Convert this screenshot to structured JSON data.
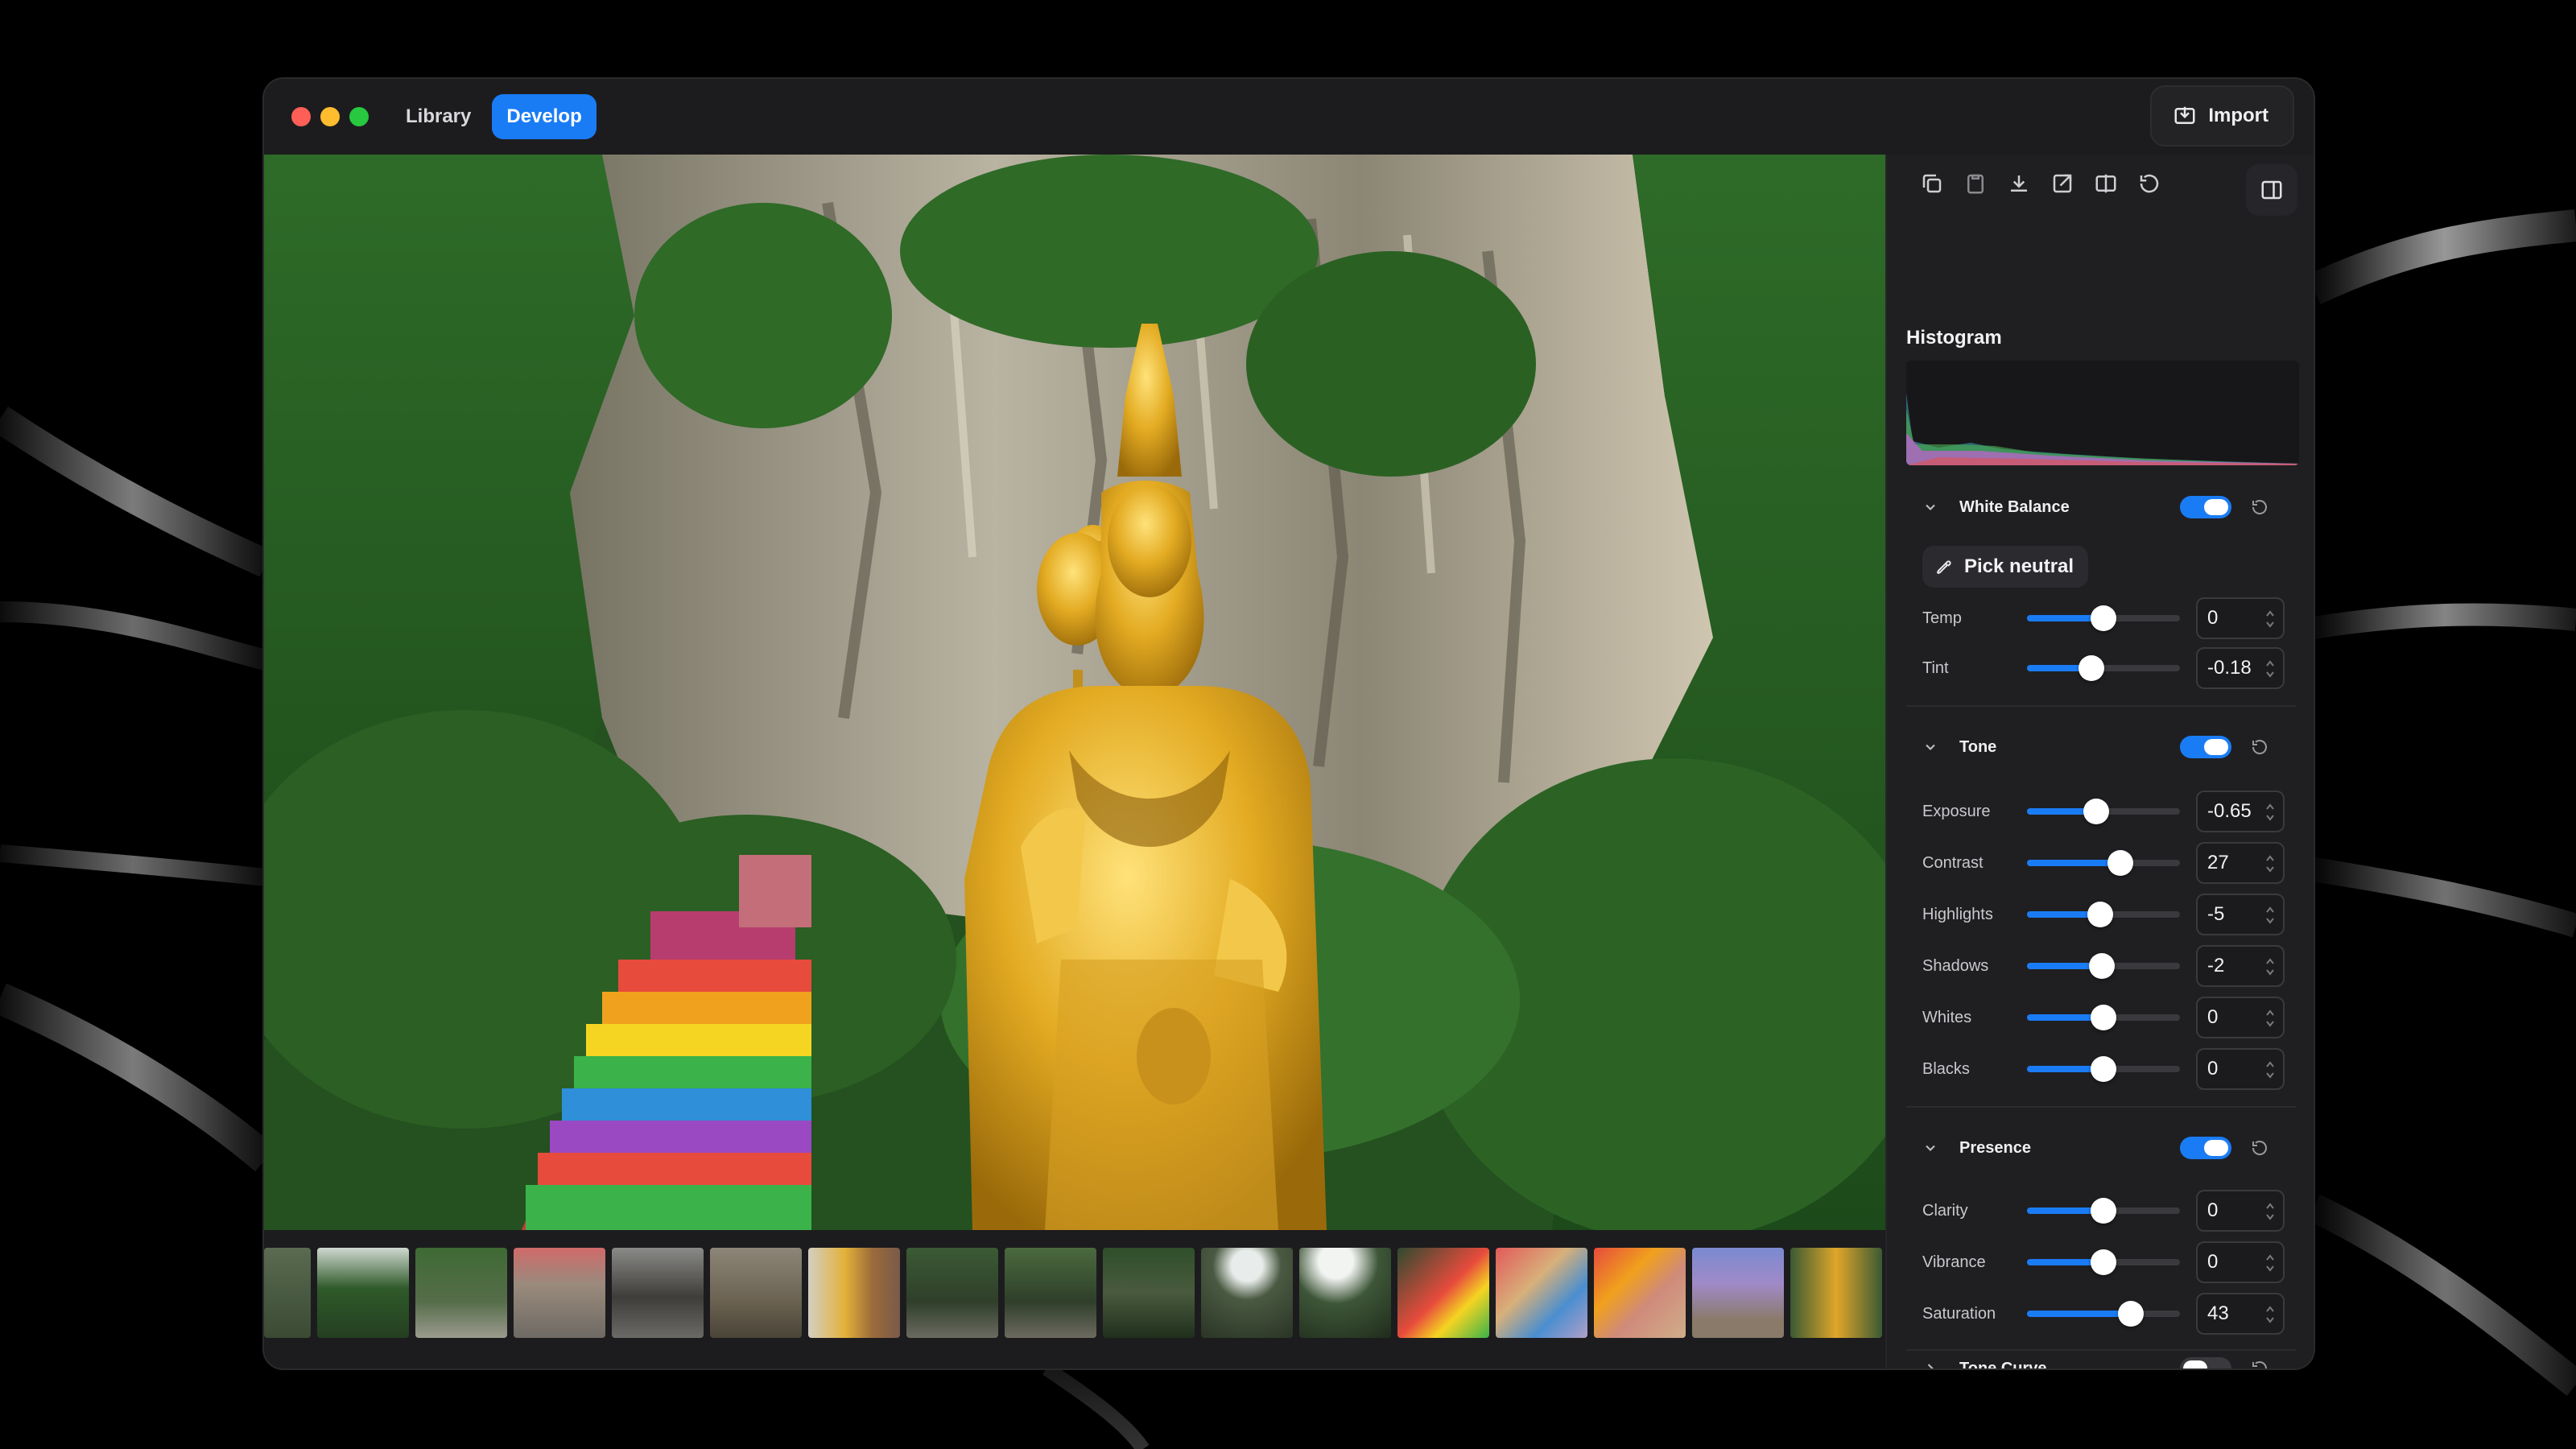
{
  "window": {
    "tabs": [
      {
        "label": "Library",
        "active": false
      },
      {
        "label": "Develop",
        "active": true
      }
    ],
    "import_label": "Import"
  },
  "panel": {
    "toolbar_icons": [
      "copy-icon",
      "paste-icon",
      "download-icon",
      "export-icon",
      "compare-icon",
      "undo-icon"
    ],
    "histogram_title": "Histogram",
    "white_balance": {
      "title": "White Balance",
      "enabled": true,
      "pick_neutral_label": "Pick neutral",
      "temp": {
        "label": "Temp",
        "value": "0",
        "position": 0.5
      },
      "tint": {
        "label": "Tint",
        "value": "-0.18",
        "position": 0.42
      }
    },
    "tone": {
      "title": "Tone",
      "enabled": true,
      "exposure": {
        "label": "Exposure",
        "value": "-0.65",
        "position": 0.45
      },
      "contrast": {
        "label": "Contrast",
        "value": "27",
        "position": 0.61
      },
      "highlights": {
        "label": "Highlights",
        "value": "-5",
        "position": 0.48
      },
      "shadows": {
        "label": "Shadows",
        "value": "-2",
        "position": 0.49
      },
      "whites": {
        "label": "Whites",
        "value": "0",
        "position": 0.5
      },
      "blacks": {
        "label": "Blacks",
        "value": "0",
        "position": 0.5
      }
    },
    "presence": {
      "title": "Presence",
      "enabled": true,
      "clarity": {
        "label": "Clarity",
        "value": "0",
        "position": 0.5
      },
      "vibrance": {
        "label": "Vibrance",
        "value": "0",
        "position": 0.5
      },
      "saturation": {
        "label": "Saturation",
        "value": "43",
        "position": 0.68
      }
    },
    "tone_curve": {
      "title": "Tone Curve",
      "enabled": false
    }
  },
  "colors": {
    "accent": "#1a7cf5",
    "gold": "#d9a520"
  }
}
